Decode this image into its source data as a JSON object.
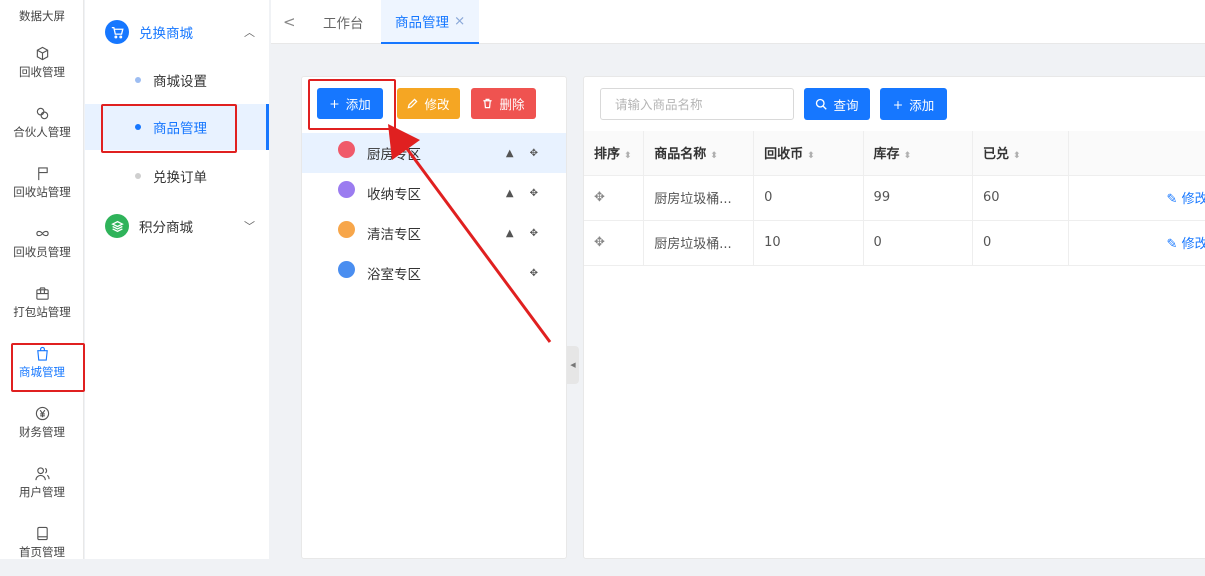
{
  "rail": {
    "top_label": "数据大屏",
    "items": [
      {
        "label": "回收管理",
        "icon": "cube-icon"
      },
      {
        "label": "合伙人管理",
        "icon": "link-icon"
      },
      {
        "label": "回收站管理",
        "icon": "flag-icon"
      },
      {
        "label": "回收员管理",
        "icon": "infinity-icon"
      },
      {
        "label": "打包站管理",
        "icon": "package-icon"
      },
      {
        "label": "商城管理",
        "icon": "shopping-bag-icon"
      },
      {
        "label": "财务管理",
        "icon": "yen-icon"
      },
      {
        "label": "用户管理",
        "icon": "users-icon"
      },
      {
        "label": "首页管理",
        "icon": "tablet-icon"
      }
    ]
  },
  "submenu": {
    "group1": "兑换商城",
    "items": [
      "商城设置",
      "商品管理",
      "兑换订单"
    ],
    "group2": "积分商城"
  },
  "tabs": {
    "home": "工作台",
    "current": "商品管理",
    "close": "×",
    "back": "<"
  },
  "categories": {
    "add": "添加",
    "edit": "修改",
    "delete": "删除",
    "items": [
      "厨房专区",
      "收纳专区",
      "清洁专区",
      "浴室专区"
    ]
  },
  "main": {
    "search_placeholder": "请输入商品名称",
    "query": "查询",
    "add": "添加",
    "columns": [
      "排序",
      "商品名称",
      "回收币",
      "库存",
      "已兑"
    ],
    "rows": [
      {
        "name": "厨房垃圾桶...",
        "coins": "0",
        "stock": "99",
        "redeemed": "60",
        "op": "修改"
      },
      {
        "name": "厨房垃圾桶...",
        "coins": "10",
        "stock": "0",
        "redeemed": "0",
        "op": "修改"
      }
    ]
  },
  "colors": {
    "primary": "#1677ff",
    "warning": "#f5a623",
    "danger": "#ef5350",
    "annotation": "#e02020"
  }
}
